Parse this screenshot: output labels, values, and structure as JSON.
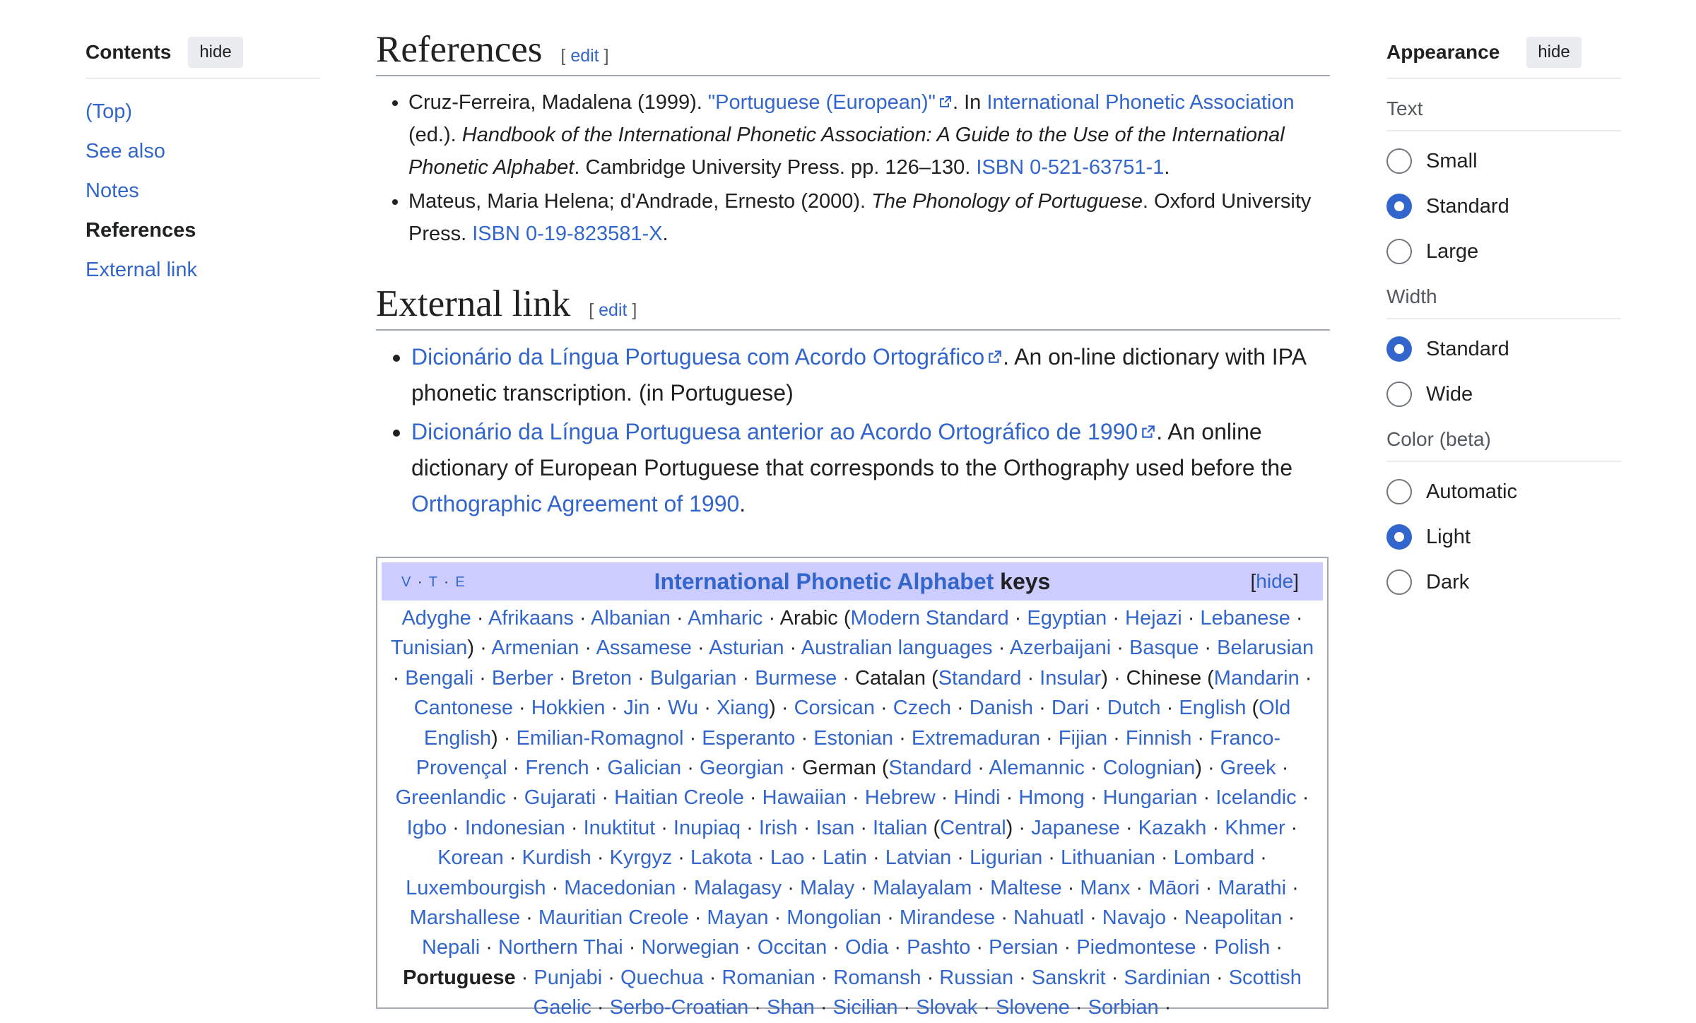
{
  "toc": {
    "title": "Contents",
    "hide_label": "hide",
    "items": [
      {
        "label": "(Top)"
      },
      {
        "label": "See also"
      },
      {
        "label": "Notes"
      },
      {
        "label": "References"
      },
      {
        "label": "External link"
      }
    ]
  },
  "references": {
    "heading": "References",
    "edit_label": "edit",
    "items": [
      {
        "a": "Cruz-Ferreira, Madalena (1999). ",
        "link1": "\"Portuguese (European)\"",
        "b": ". In ",
        "link2": "International Phonetic Association",
        "c": " (ed.). ",
        "italic": "Handbook of the International Phonetic Association: A Guide to the Use of the International Phonetic Alphabet",
        "d": ". Cambridge University Press. pp. 126–130. ",
        "isbn": "ISBN 0-521-63751-1",
        "e": "."
      },
      {
        "a": "Mateus, Maria Helena; d'Andrade, Ernesto (2000). ",
        "italic": "The Phonology of Portuguese",
        "b": ". Oxford University Press. ",
        "isbn": "ISBN 0-19-823581-X",
        "c": "."
      }
    ]
  },
  "external": {
    "heading": "External link",
    "edit_label": "edit",
    "items": [
      {
        "link": "Dicionário da Língua Portuguesa com Acordo Ortográfico",
        "text": ". An on-line dictionary with IPA phonetic transcription. (in Portuguese)"
      },
      {
        "link": "Dicionário da Língua Portuguesa anterior ao Acordo Ortográfico de 1990",
        "text": ". An online dictionary of European Portuguese that corresponds to the Orthography used before the ",
        "link2": "Orthographic Agreement of 1990",
        "text2": "."
      }
    ]
  },
  "navbox": {
    "v": "V",
    "t": "T",
    "e": "E",
    "title_link": "International Phonetic Alphabet",
    "title_rest": " keys",
    "hide_label": "hide",
    "entries": [
      {
        "t": "Adyghe",
        "l": 1
      },
      {
        "t": "Afrikaans",
        "l": 1
      },
      {
        "t": "Albanian",
        "l": 1
      },
      {
        "t": "Amharic",
        "l": 1
      },
      {
        "t": "Arabic (",
        "l": 0,
        "ns": 1
      },
      {
        "t": "Modern Standard",
        "l": 1
      },
      {
        "t": "Egyptian",
        "l": 1
      },
      {
        "t": "Hejazi",
        "l": 1
      },
      {
        "t": "Lebanese",
        "l": 1
      },
      {
        "t": "Tunisian",
        "l": 1,
        "close": 1
      },
      {
        "t": "Armenian",
        "l": 1
      },
      {
        "t": "Assamese",
        "l": 1
      },
      {
        "t": "Asturian",
        "l": 1
      },
      {
        "t": "Australian languages",
        "l": 1
      },
      {
        "t": "Azerbaijani",
        "l": 1
      },
      {
        "t": "Basque",
        "l": 1
      },
      {
        "t": "Belarusian",
        "l": 1
      },
      {
        "t": "Bengali",
        "l": 1
      },
      {
        "t": "Berber",
        "l": 1
      },
      {
        "t": "Breton",
        "l": 1
      },
      {
        "t": "Bulgarian",
        "l": 1
      },
      {
        "t": "Burmese",
        "l": 1
      },
      {
        "t": "Catalan (",
        "l": 0,
        "ns": 1
      },
      {
        "t": "Standard",
        "l": 1
      },
      {
        "t": "Insular",
        "l": 1,
        "close": 1
      },
      {
        "t": "Chinese (",
        "l": 0,
        "ns": 1
      },
      {
        "t": "Mandarin",
        "l": 1
      },
      {
        "t": "Cantonese",
        "l": 1
      },
      {
        "t": "Hokkien",
        "l": 1
      },
      {
        "t": "Jin",
        "l": 1
      },
      {
        "t": "Wu",
        "l": 1
      },
      {
        "t": "Xiang",
        "l": 1,
        "close": 1
      },
      {
        "t": "Corsican",
        "l": 1
      },
      {
        "t": "Czech",
        "l": 1
      },
      {
        "t": "Danish",
        "l": 1
      },
      {
        "t": "Dari",
        "l": 1
      },
      {
        "t": "Dutch",
        "l": 1
      },
      {
        "t": "English (",
        "l": 0,
        "ns": 1,
        "link_part": "English"
      },
      {
        "t": "Old English",
        "l": 1,
        "close": 1
      },
      {
        "t": "Emilian-Romagnol",
        "l": 1
      },
      {
        "t": "Esperanto",
        "l": 1
      },
      {
        "t": "Estonian",
        "l": 1
      },
      {
        "t": "Extremaduran",
        "l": 1
      },
      {
        "t": "Fijian",
        "l": 1
      },
      {
        "t": "Finnish",
        "l": 1
      },
      {
        "t": "Franco-Provençal",
        "l": 1
      },
      {
        "t": "French",
        "l": 1
      },
      {
        "t": "Galician",
        "l": 1
      },
      {
        "t": "Georgian",
        "l": 1
      },
      {
        "t": "German (",
        "l": 0,
        "ns": 1
      },
      {
        "t": "Standard",
        "l": 1
      },
      {
        "t": "Alemannic",
        "l": 1
      },
      {
        "t": "Colognian",
        "l": 1,
        "close": 1
      },
      {
        "t": "Greek",
        "l": 1
      },
      {
        "t": "Greenlandic",
        "l": 1
      },
      {
        "t": "Gujarati",
        "l": 1
      },
      {
        "t": "Haitian Creole",
        "l": 1
      },
      {
        "t": "Hawaiian",
        "l": 1
      },
      {
        "t": "Hebrew",
        "l": 1
      },
      {
        "t": "Hindi",
        "l": 1
      },
      {
        "t": "Hmong",
        "l": 1
      },
      {
        "t": "Hungarian",
        "l": 1
      },
      {
        "t": "Icelandic",
        "l": 1
      },
      {
        "t": "Igbo",
        "l": 1
      },
      {
        "t": "Indonesian",
        "l": 1
      },
      {
        "t": "Inuktitut",
        "l": 1
      },
      {
        "t": "Inupiaq",
        "l": 1
      },
      {
        "t": "Irish",
        "l": 1
      },
      {
        "t": "Isan",
        "l": 1
      },
      {
        "t": "Italian (",
        "l": 0,
        "ns": 1,
        "link_part": "Italian"
      },
      {
        "t": "Central",
        "l": 1,
        "close": 1
      },
      {
        "t": "Japanese",
        "l": 1
      },
      {
        "t": "Kazakh",
        "l": 1
      },
      {
        "t": "Khmer",
        "l": 1
      },
      {
        "t": "Korean",
        "l": 1
      },
      {
        "t": "Kurdish",
        "l": 1
      },
      {
        "t": "Kyrgyz",
        "l": 1
      },
      {
        "t": "Lakota",
        "l": 1
      },
      {
        "t": "Lao",
        "l": 1
      },
      {
        "t": "Latin",
        "l": 1
      },
      {
        "t": "Latvian",
        "l": 1
      },
      {
        "t": "Ligurian",
        "l": 1
      },
      {
        "t": "Lithuanian",
        "l": 1
      },
      {
        "t": "Lombard",
        "l": 1
      },
      {
        "t": "Luxembourgish",
        "l": 1
      },
      {
        "t": "Macedonian",
        "l": 1
      },
      {
        "t": "Malagasy",
        "l": 1
      },
      {
        "t": "Malay",
        "l": 1
      },
      {
        "t": "Malayalam",
        "l": 1
      },
      {
        "t": "Maltese",
        "l": 1
      },
      {
        "t": "Manx",
        "l": 1
      },
      {
        "t": "Māori",
        "l": 1
      },
      {
        "t": "Marathi",
        "l": 1
      },
      {
        "t": "Marshallese",
        "l": 1
      },
      {
        "t": "Mauritian Creole",
        "l": 1
      },
      {
        "t": "Mayan",
        "l": 1
      },
      {
        "t": "Mongolian",
        "l": 1
      },
      {
        "t": "Mirandese",
        "l": 1
      },
      {
        "t": "Nahuatl",
        "l": 1
      },
      {
        "t": "Navajo",
        "l": 1
      },
      {
        "t": "Neapolitan",
        "l": 1
      },
      {
        "t": "Nepali",
        "l": 1
      },
      {
        "t": "Northern Thai",
        "l": 1
      },
      {
        "t": "Norwegian",
        "l": 1
      },
      {
        "t": "Occitan",
        "l": 1
      },
      {
        "t": "Odia",
        "l": 1
      },
      {
        "t": "Pashto",
        "l": 1
      },
      {
        "t": "Persian",
        "l": 1
      },
      {
        "t": "Piedmontese",
        "l": 1
      },
      {
        "t": "Polish",
        "l": 1
      },
      {
        "t": "Portuguese",
        "l": 0,
        "bold": 1
      },
      {
        "t": "Punjabi",
        "l": 1
      },
      {
        "t": "Quechua",
        "l": 1
      },
      {
        "t": "Romanian",
        "l": 1
      },
      {
        "t": "Romansh",
        "l": 1
      },
      {
        "t": "Russian",
        "l": 1
      },
      {
        "t": "Sanskrit",
        "l": 1
      },
      {
        "t": "Sardinian",
        "l": 1
      },
      {
        "t": "Scottish Gaelic",
        "l": 1
      },
      {
        "t": "Serbo-Croatian",
        "l": 1
      },
      {
        "t": "Shan",
        "l": 1
      },
      {
        "t": "Sicilian",
        "l": 1
      },
      {
        "t": "Slovak",
        "l": 1
      },
      {
        "t": "Slovene",
        "l": 1
      },
      {
        "t": "Sorbian",
        "l": 1
      }
    ]
  },
  "appearance": {
    "title": "Appearance",
    "hide_label": "hide",
    "groups": [
      {
        "title": "Text",
        "options": [
          {
            "label": "Small",
            "checked": false
          },
          {
            "label": "Standard",
            "checked": true
          },
          {
            "label": "Large",
            "checked": false
          }
        ]
      },
      {
        "title": "Width",
        "options": [
          {
            "label": "Standard",
            "checked": true
          },
          {
            "label": "Wide",
            "checked": false
          }
        ]
      },
      {
        "title": "Color (beta)",
        "options": [
          {
            "label": "Automatic",
            "checked": false
          },
          {
            "label": "Light",
            "checked": true
          },
          {
            "label": "Dark",
            "checked": false
          }
        ]
      }
    ]
  },
  "colors": {
    "link": "#3366cc",
    "navbox_title_bg": "#ccccff",
    "radio_checked": "#3366cc"
  }
}
